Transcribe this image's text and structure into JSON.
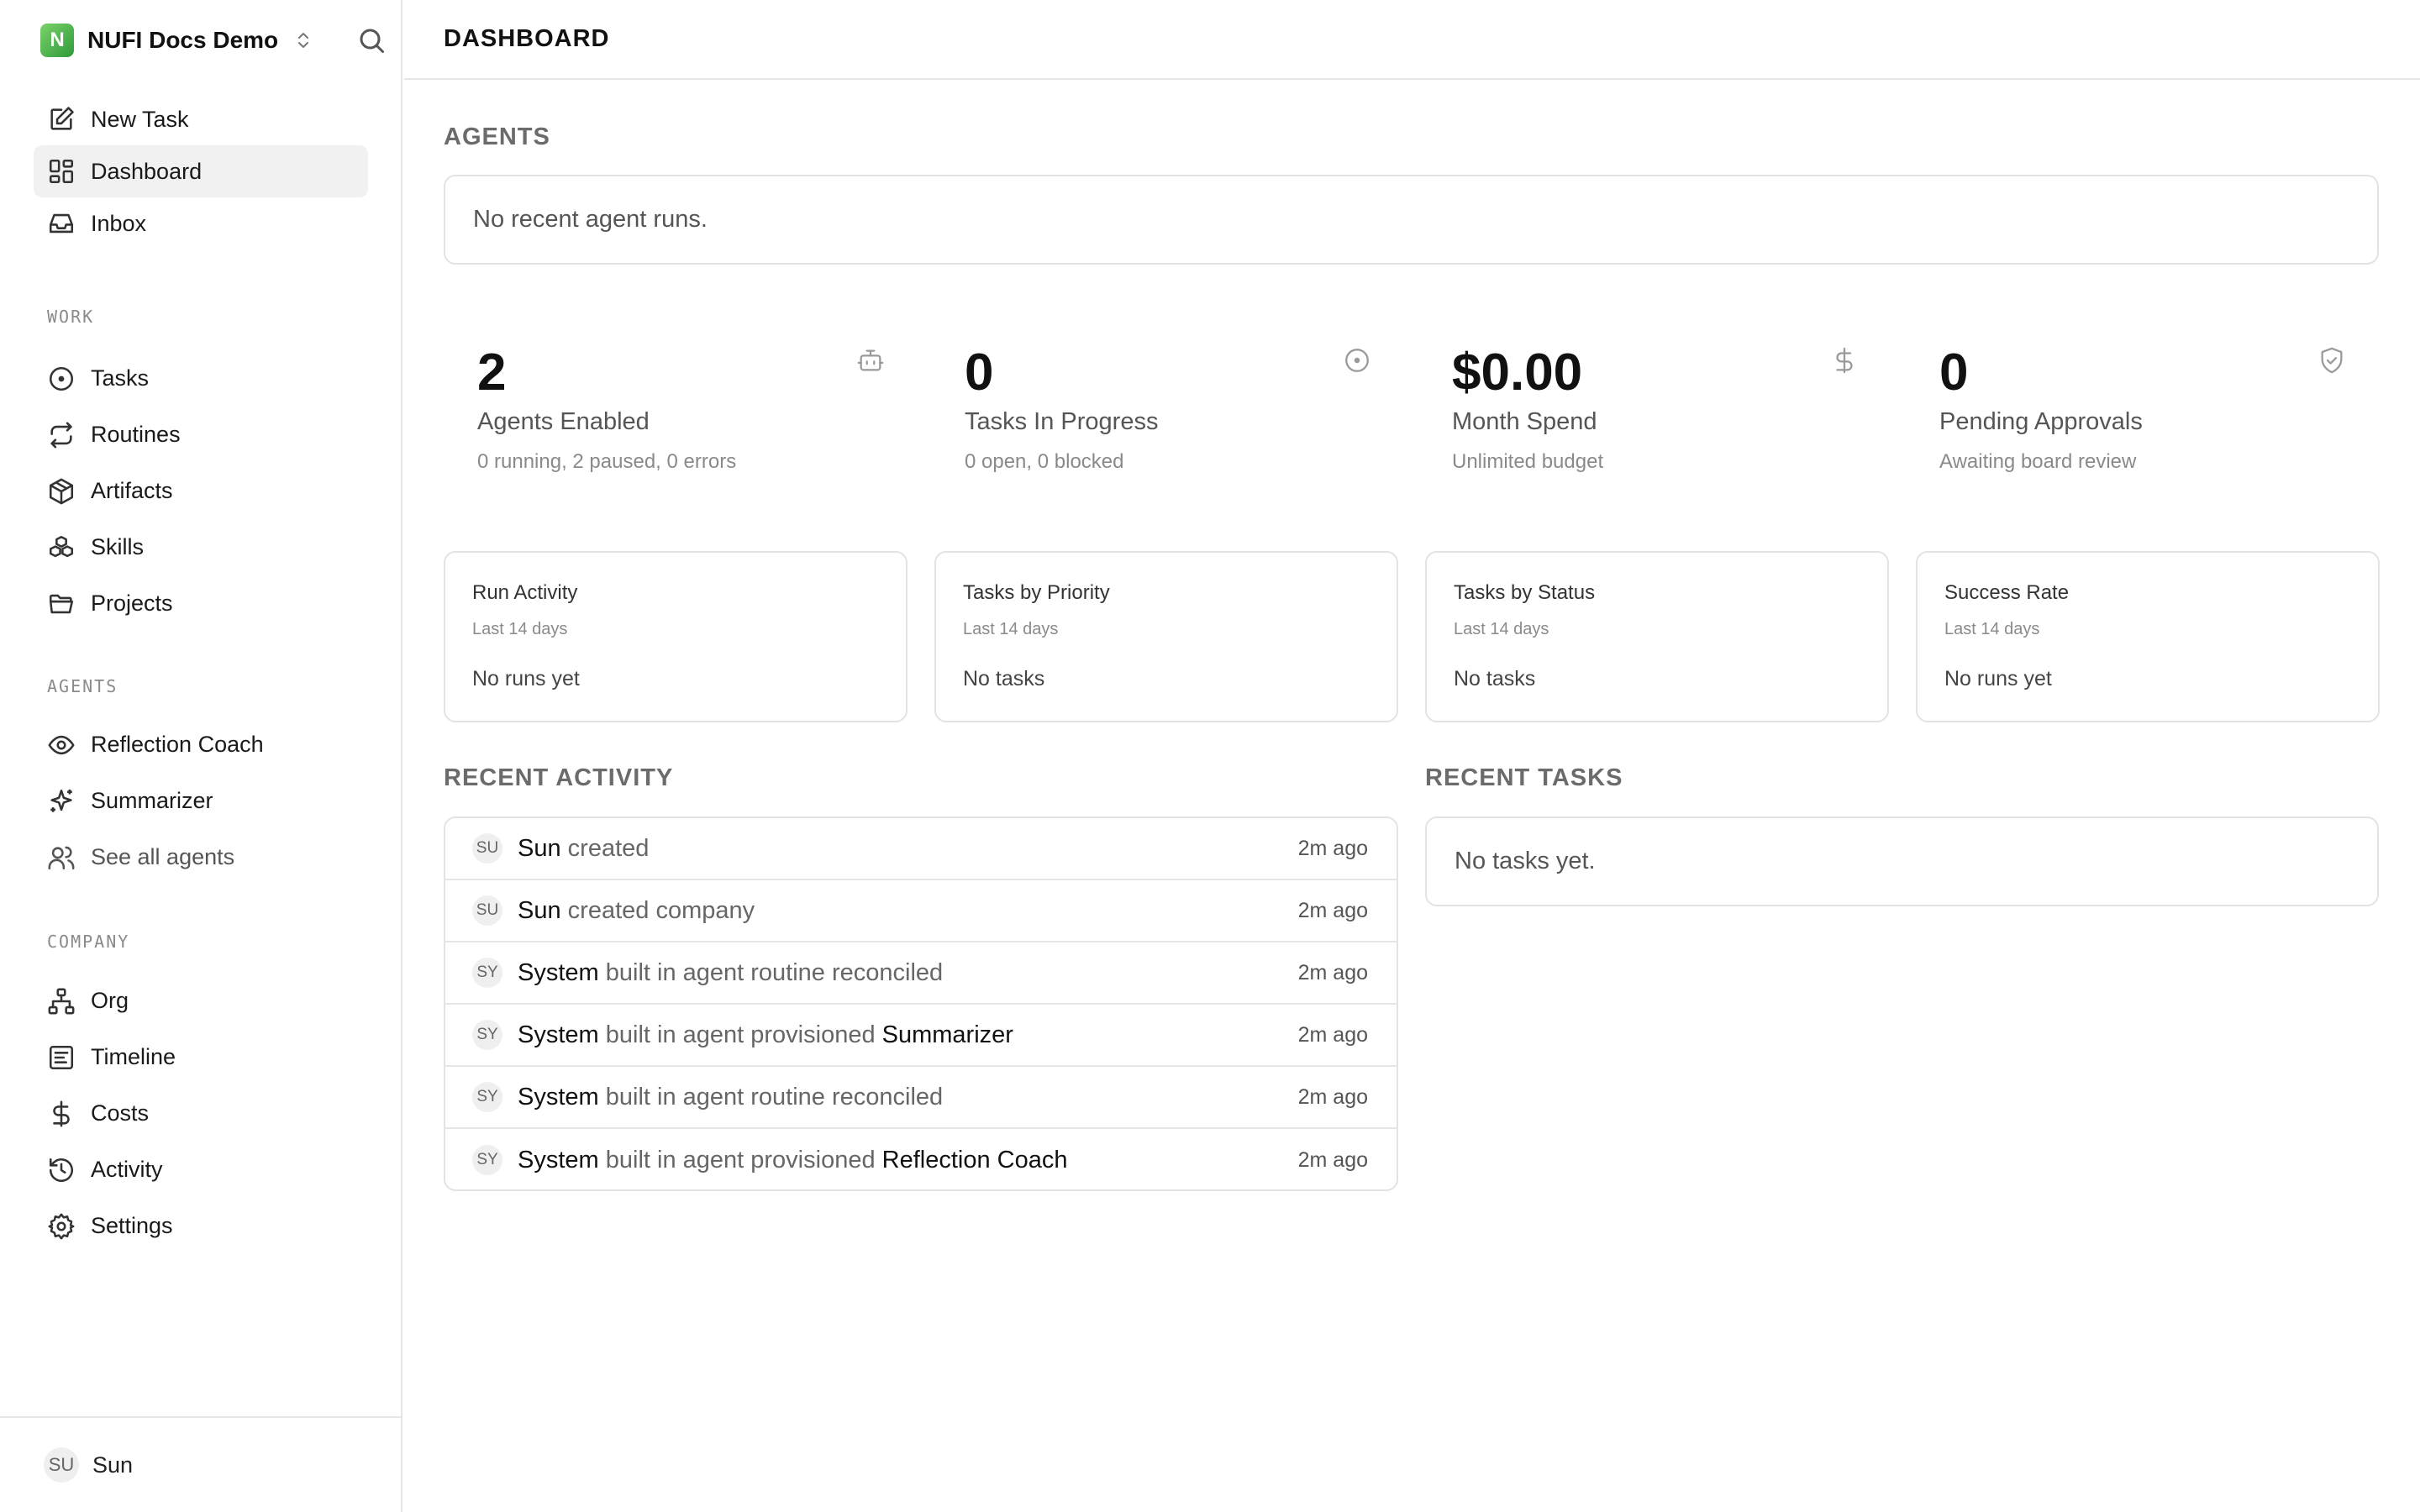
{
  "workspace": {
    "logo_letter": "N",
    "name": "NUFI Docs Demo"
  },
  "nav_top": [
    {
      "label": "New Task",
      "icon": "edit-icon"
    },
    {
      "label": "Dashboard",
      "icon": "dashboard-icon",
      "active": true
    },
    {
      "label": "Inbox",
      "icon": "inbox-icon"
    }
  ],
  "sections": {
    "work": "WORK",
    "agents": "AGENTS",
    "company": "COMPANY"
  },
  "nav_work": [
    {
      "label": "Tasks",
      "icon": "circle-dot-icon"
    },
    {
      "label": "Routines",
      "icon": "repeat-icon"
    },
    {
      "label": "Artifacts",
      "icon": "package-icon"
    },
    {
      "label": "Skills",
      "icon": "boxes-icon"
    },
    {
      "label": "Projects",
      "icon": "folder-icon"
    }
  ],
  "nav_agents": [
    {
      "label": "Reflection Coach",
      "icon": "eye-icon"
    },
    {
      "label": "Summarizer",
      "icon": "sparkles-icon"
    },
    {
      "label": "See all agents",
      "icon": "users-icon"
    }
  ],
  "nav_company": [
    {
      "label": "Org",
      "icon": "org-chart-icon"
    },
    {
      "label": "Timeline",
      "icon": "timeline-icon"
    },
    {
      "label": "Costs",
      "icon": "dollar-icon"
    },
    {
      "label": "Activity",
      "icon": "history-icon"
    },
    {
      "label": "Settings",
      "icon": "gear-icon"
    }
  ],
  "user": {
    "initials": "SU",
    "name": "Sun"
  },
  "header": {
    "title": "DASHBOARD"
  },
  "agents_section": {
    "title": "AGENTS",
    "empty": "No recent agent runs."
  },
  "metrics": [
    {
      "value": "2",
      "label": "Agents Enabled",
      "sub": "0 running, 2 paused, 0 errors",
      "icon": "bot-icon"
    },
    {
      "value": "0",
      "label": "Tasks In Progress",
      "sub": "0 open, 0 blocked",
      "icon": "circle-dot-icon"
    },
    {
      "value": "$0.00",
      "label": "Month Spend",
      "sub": "Unlimited budget",
      "icon": "dollar-icon"
    },
    {
      "value": "0",
      "label": "Pending Approvals",
      "sub": "Awaiting board review",
      "icon": "shield-check-icon"
    }
  ],
  "charts": [
    {
      "title": "Run Activity",
      "subtitle": "Last 14 days",
      "empty": "No runs yet"
    },
    {
      "title": "Tasks by Priority",
      "subtitle": "Last 14 days",
      "empty": "No tasks"
    },
    {
      "title": "Tasks by Status",
      "subtitle": "Last 14 days",
      "empty": "No tasks"
    },
    {
      "title": "Success Rate",
      "subtitle": "Last 14 days",
      "empty": "No runs yet"
    }
  ],
  "recent_activity": {
    "title": "RECENT ACTIVITY",
    "items": [
      {
        "initials": "SU",
        "actor": "Sun",
        "action": "created",
        "target": "",
        "time": "2m ago"
      },
      {
        "initials": "SU",
        "actor": "Sun",
        "action": "created company",
        "target": "",
        "time": "2m ago"
      },
      {
        "initials": "SY",
        "actor": "System",
        "action": "built in agent routine reconciled",
        "target": "",
        "time": "2m ago"
      },
      {
        "initials": "SY",
        "actor": "System",
        "action": "built in agent provisioned",
        "target": "Summarizer",
        "time": "2m ago"
      },
      {
        "initials": "SY",
        "actor": "System",
        "action": "built in agent routine reconciled",
        "target": "",
        "time": "2m ago"
      },
      {
        "initials": "SY",
        "actor": "System",
        "action": "built in agent provisioned",
        "target": "Reflection Coach",
        "time": "2m ago"
      }
    ]
  },
  "recent_tasks": {
    "title": "RECENT TASKS",
    "empty": "No tasks yet."
  }
}
